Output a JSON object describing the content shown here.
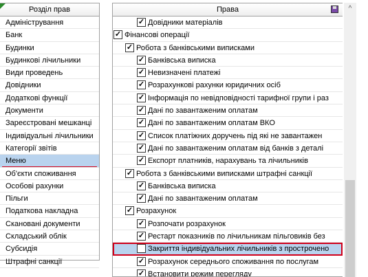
{
  "left_header": "Розділ прав",
  "left_items": [
    "Адміністрування",
    "Банк",
    "Будинки",
    "Будинкові лічильники",
    "Види проведень",
    "Довідники",
    "Додаткові функції",
    "Документи",
    "Зареєстровані мешканці",
    "Індивідуальні лічильники",
    "Категорії звітів",
    "Меню",
    "Об'єкти споживання",
    "Особові рахунки",
    "Пільги",
    "Податкова накладна",
    "Скановані документи",
    "Складський облік",
    "Субсидія",
    "Штрафні санкції"
  ],
  "left_selected_index": 11,
  "right_header": "Права",
  "right_items": [
    {
      "level": 2,
      "checked": true,
      "label": "Довідники матеріалів"
    },
    {
      "level": 0,
      "checked": true,
      "label": "Фінансові операції"
    },
    {
      "level": 1,
      "checked": true,
      "label": "Робота з банківськими виписками"
    },
    {
      "level": 2,
      "checked": true,
      "label": "Банківська виписка"
    },
    {
      "level": 2,
      "checked": true,
      "label": "Невизначені платежі"
    },
    {
      "level": 2,
      "checked": true,
      "label": "Розрахункові рахунки юридичних осіб"
    },
    {
      "level": 2,
      "checked": true,
      "label": "Інформація по невідповідності тарифної групи і раз"
    },
    {
      "level": 2,
      "checked": true,
      "label": "Дані по завантаженим оплатам"
    },
    {
      "level": 2,
      "checked": true,
      "label": "Дані по завантаженим оплатам ВКО"
    },
    {
      "level": 2,
      "checked": true,
      "label": "Список платіжних доручень під які не завантажен"
    },
    {
      "level": 2,
      "checked": true,
      "label": "Дані по завантаженим оплатам від банків з деталі"
    },
    {
      "level": 2,
      "checked": true,
      "label": "Експорт платників, нарахувань та лічильників"
    },
    {
      "level": 1,
      "checked": true,
      "label": "Робота з банківськими виписками штрафні санкції"
    },
    {
      "level": 2,
      "checked": true,
      "label": "Банківська виписка"
    },
    {
      "level": 2,
      "checked": true,
      "label": "Дані по завантаженим оплатам"
    },
    {
      "level": 1,
      "checked": true,
      "label": "Розрахунок"
    },
    {
      "level": 2,
      "checked": true,
      "label": "Розпочати розрахунок"
    },
    {
      "level": 2,
      "checked": true,
      "label": "Рестарт показників по лічильникам пільговиків без"
    },
    {
      "level": 2,
      "checked": false,
      "label": "Закриття індивідуальних лічильників з прострочено"
    },
    {
      "level": 2,
      "checked": true,
      "label": "Розрахунок середнього споживання по послугам"
    },
    {
      "level": 2,
      "checked": true,
      "label": "Встановити режим перегляду"
    }
  ],
  "right_highlight_index": 18,
  "colors": {
    "selection": "#b9d3ee",
    "highlight_border": "#d0001a"
  },
  "icons": {
    "save": "save-icon",
    "scroll_up": "chevron-up-icon"
  }
}
